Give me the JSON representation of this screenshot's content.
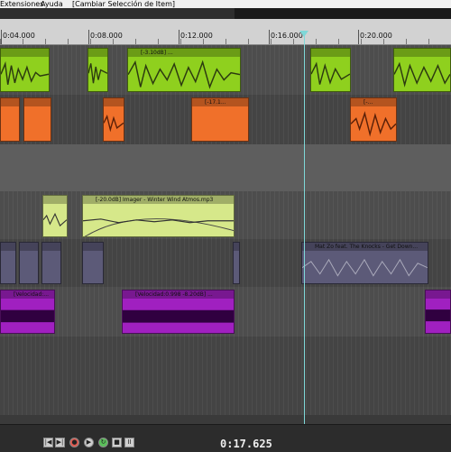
{
  "menu": {
    "extensions": "Extensiones",
    "help": "Ayuda",
    "change_item_selection": "[Cambiar Selección de Item]"
  },
  "ruler": {
    "labels": [
      "0:04.000",
      "0:08.000",
      "0:12.000",
      "0:16.000",
      "0:20.000"
    ]
  },
  "items": {
    "green_clip_label": "[-3.10dB] ...",
    "orange_clip_label": "[-17.1...",
    "orange_clip2_label": "[-...",
    "imager_label": "[-20.0dB] Imager - Winter Wind Atmos.mp3",
    "matzo_label": "Mat Zo feat. The Knocks - Get Down...",
    "velocidad_short": "[Velocidad:...",
    "velocidad_label": "[Velocidad:0.998 -8.20dB] ..."
  },
  "transport": {
    "time": "0:17.625"
  },
  "colors": {
    "green": "#8fd01e",
    "orange": "#f0702a",
    "yellow": "#d6e88a",
    "purple": "#5c5a78",
    "magenta": "#a020c0",
    "cursor": "#7fd8d8"
  }
}
